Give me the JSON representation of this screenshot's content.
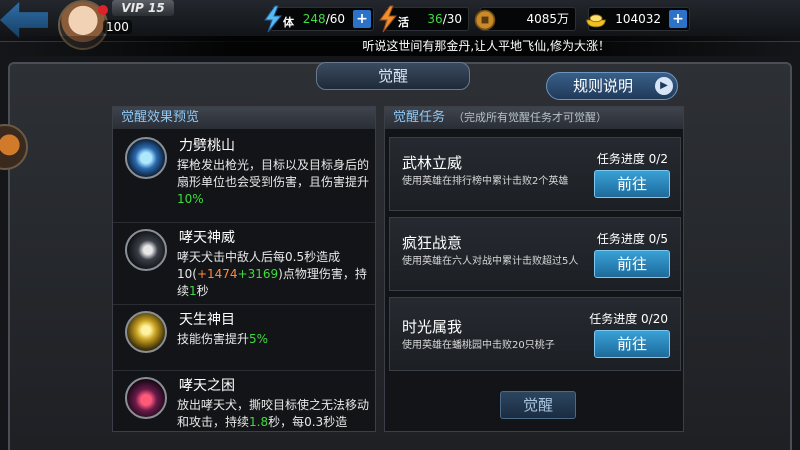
{
  "header": {
    "vip": "VIP 15",
    "level": "100",
    "stamina": {
      "tag": "体",
      "value": "248",
      "max": "/60"
    },
    "vigor": {
      "tag": "活",
      "value": "36",
      "max": "/30"
    },
    "coins": "4085万",
    "gold": "104032",
    "plus": "+"
  },
  "marquee": "听说这世间有那金丹,让人平地飞仙,修为大涨！",
  "title": "觉醒",
  "rules_button": "规则说明",
  "left_panel": {
    "title": "觉醒效果预览",
    "effects": [
      {
        "name": "力劈桃山",
        "desc_a": "挥枪发出枪光，目标以及目标身后的扇形单位也会受到伤害，且伤害提升",
        "desc_b": "10%"
      },
      {
        "name": "哮天神威",
        "desc_a": "哮天犬击中敌人后每0.5秒造成10(",
        "desc_b": "+1474",
        "desc_c": "+3169",
        "desc_d": ")点物理伤害，持续",
        "desc_e": "1",
        "desc_f": "秒"
      },
      {
        "name": "天生神目",
        "desc_a": "技能伤害提升",
        "desc_b": "5%"
      },
      {
        "name": "哮天之困",
        "desc_a": "放出哮天犬，撕咬目标使之无法移动和攻击，持续",
        "desc_b": "1.8",
        "desc_c": "秒，每0.3秒造"
      }
    ]
  },
  "right_panel": {
    "title": "觉醒任务",
    "subtitle": "（完成所有觉醒任务才可觉醒）",
    "quests": [
      {
        "name": "武林立威",
        "desc": "使用英雄在排行榜中累计击败2个英雄",
        "progress": "任务进度 0/2",
        "button": "前往"
      },
      {
        "name": "疯狂战意",
        "desc": "使用英雄在六人对战中累计击败超过5人",
        "progress": "任务进度 0/5",
        "button": "前往"
      },
      {
        "name": "时光属我",
        "desc": "使用英雄在蟠桃园中击败20只桃子",
        "progress": "任务进度 0/20",
        "button": "前往"
      }
    ]
  },
  "awaken_button": "觉醒",
  "colors": {
    "accent_green": "#3fdc3f",
    "accent_orange": "#ff8a3a",
    "button_blue": "#3aa0d6"
  }
}
